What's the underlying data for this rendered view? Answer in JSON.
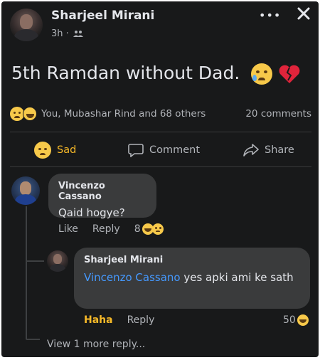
{
  "post": {
    "author": "Sharjeel Mirani",
    "time": "3h ·",
    "privacy_icon": "friends-icon",
    "text": "5th Ramdan without Dad.",
    "text_emojis": [
      "crying-face",
      "broken-heart"
    ]
  },
  "header_actions": {
    "more": "•••",
    "close": "✕"
  },
  "reactions": {
    "icons": [
      "sad",
      "haha"
    ],
    "summary": "You, Mubashar Rind and 68 others",
    "comments": "20 comments"
  },
  "actions": {
    "react": "Sad",
    "comment": "Comment",
    "share": "Share"
  },
  "comment1": {
    "author": "Vincenzo Cassano",
    "text": "Qaid hogye?",
    "like": "Like",
    "reply": "Reply",
    "reaction_count": "8"
  },
  "reply1": {
    "author": "Sharjeel Mirani",
    "mention": "Vincenzo Cassano",
    "text": " yes apki ami ke sath",
    "reaction_label": "Haha",
    "reply": "Reply",
    "reaction_count": "50"
  },
  "more_replies": "View 1 more reply...",
  "colors": {
    "background": "#18191a",
    "bubble": "#3a3b3c",
    "mention": "#4599ff",
    "reaction_yellow": "#f7b928"
  }
}
